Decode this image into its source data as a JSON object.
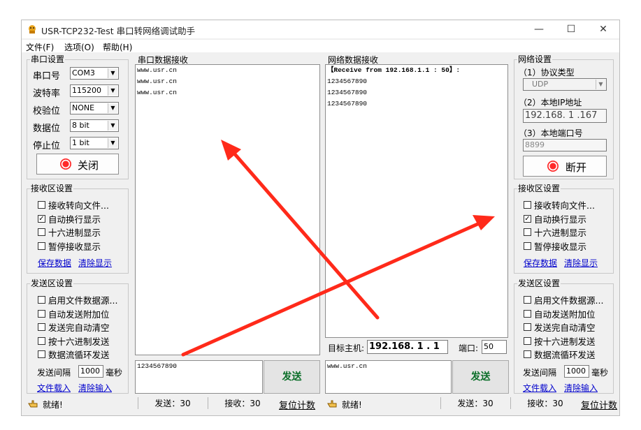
{
  "window": {
    "title": "USR-TCP232-Test 串口转网络调试助手",
    "controls": {
      "minimize": "—",
      "maximize": "☐",
      "close": "✕"
    }
  },
  "menu": [
    "文件(F)",
    "选项(O)",
    "帮助(H)"
  ],
  "serial_settings": {
    "title": "串口设置",
    "port_label": "串口号",
    "port_value": "COM3",
    "baud_label": "波特率",
    "baud_value": "115200",
    "parity_label": "校验位",
    "parity_value": "NONE",
    "databits_label": "数据位",
    "databits_value": "8 bit",
    "stopbits_label": "停止位",
    "stopbits_value": "1 bit",
    "close_button": "关闭"
  },
  "left_receive_settings": {
    "title": "接收区设置",
    "options": [
      {
        "label": "接收转向文件...",
        "checked": false
      },
      {
        "label": "自动换行显示",
        "checked": true
      },
      {
        "label": "十六进制显示",
        "checked": false
      },
      {
        "label": "暂停接收显示",
        "checked": false
      }
    ],
    "save_link": "保存数据",
    "clear_link": "清除显示"
  },
  "left_send_settings": {
    "title": "发送区设置",
    "options": [
      {
        "label": "启用文件数据源...",
        "checked": false
      },
      {
        "label": "自动发送附加位",
        "checked": false
      },
      {
        "label": "发送完自动清空",
        "checked": false
      },
      {
        "label": "按十六进制发送",
        "checked": false
      },
      {
        "label": "数据流循环发送",
        "checked": false
      }
    ],
    "interval_label": "发送间隔",
    "interval_value": "1000",
    "interval_unit": "毫秒",
    "load_link": "文件载入",
    "clear_input_link": "清除输入"
  },
  "serial_receive": {
    "title": "串口数据接收",
    "lines": [
      "www.usr.cn",
      "www.usr.cn",
      "www.usr.cn"
    ]
  },
  "serial_send": {
    "text": "1234567890",
    "send_button": "发送"
  },
  "network_receive": {
    "title": "网络数据接收",
    "lines": [
      "【Receive from 192.168.1.1 : 50】:",
      "1234567890",
      "1234567890",
      "1234567890"
    ]
  },
  "target": {
    "host_label": "目标主机:",
    "host_value": "192.168. 1 . 1",
    "port_label": "端口:",
    "port_value": "50"
  },
  "network_send": {
    "text": "www.usr.cn",
    "send_button": "发送"
  },
  "network_settings": {
    "title": "网络设置",
    "protocol_label": "（1）协议类型",
    "protocol_value": "UDP",
    "local_ip_label": "（2）本地IP地址",
    "local_ip_value": "192.168. 1 .167",
    "local_port_label": "（3）本地端口号",
    "local_port_value": "8899",
    "disconnect_button": "断开"
  },
  "right_receive_settings": {
    "title": "接收区设置",
    "options": [
      {
        "label": "接收转向文件...",
        "checked": false
      },
      {
        "label": "自动换行显示",
        "checked": true
      },
      {
        "label": "十六进制显示",
        "checked": false
      },
      {
        "label": "暂停接收显示",
        "checked": false
      }
    ],
    "save_link": "保存数据",
    "clear_link": "清除显示"
  },
  "right_send_settings": {
    "title": "发送区设置",
    "options": [
      {
        "label": "启用文件数据源...",
        "checked": false
      },
      {
        "label": "自动发送附加位",
        "checked": false
      },
      {
        "label": "发送完自动清空",
        "checked": false
      },
      {
        "label": "按十六进制发送",
        "checked": false
      },
      {
        "label": "数据流循环发送",
        "checked": false
      }
    ],
    "interval_label": "发送间隔",
    "interval_value": "1000",
    "interval_unit": "毫秒",
    "load_link": "文件载入",
    "clear_input_link": "清除输入"
  },
  "status_left": {
    "ready": "就绪!",
    "sent": "发送：30",
    "received": "接收：30",
    "reset": "复位计数"
  },
  "status_right": {
    "ready": "就绪!",
    "sent": "发送：30",
    "received": "接收：30",
    "reset": "复位计数"
  },
  "colors": {
    "arrow": "#ff2a1a",
    "send_text": "#0a6e28",
    "link": "#0000cc",
    "lamp": "#ff2a2a"
  }
}
